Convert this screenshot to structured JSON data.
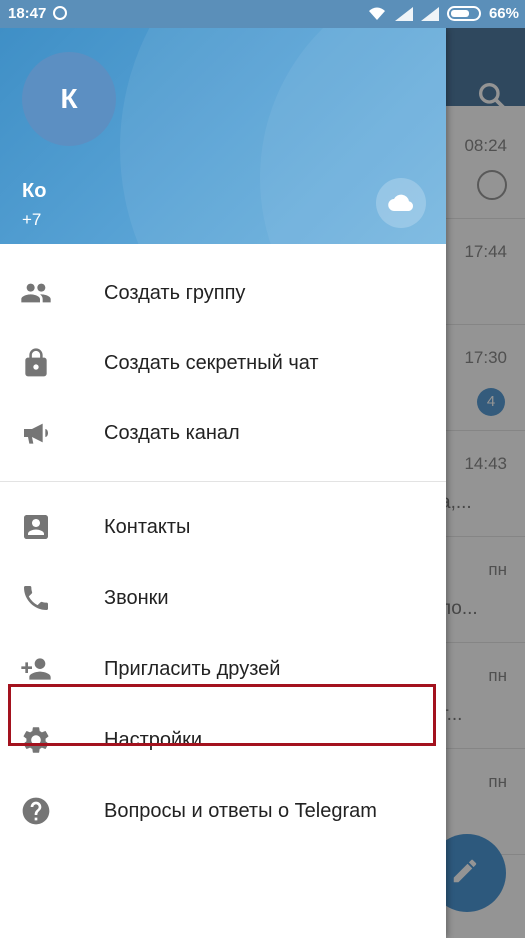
{
  "status_bar": {
    "time": "18:47",
    "battery": "66%"
  },
  "drawer": {
    "avatar_letter": "К",
    "user_name": "Ко",
    "user_phone": "+7",
    "menu_group_1": [
      {
        "label": "Создать группу",
        "icon": "group-icon"
      },
      {
        "label": "Создать секретный чат",
        "icon": "lock-icon"
      },
      {
        "label": "Создать канал",
        "icon": "megaphone-icon"
      }
    ],
    "menu_group_2": [
      {
        "label": "Контакты",
        "icon": "contact-card-icon"
      },
      {
        "label": "Звонки",
        "icon": "phone-icon"
      },
      {
        "label": "Пригласить друзей",
        "icon": "add-person-icon"
      },
      {
        "label": "Настройки",
        "icon": "gear-icon"
      },
      {
        "label": "Вопросы и ответы о Telegram",
        "icon": "help-icon"
      }
    ]
  },
  "background_chats": [
    {
      "time": "08:24",
      "snippet": ""
    },
    {
      "time": "17:44",
      "snippet": ""
    },
    {
      "time": "17:30",
      "snippet": "",
      "badge": "4"
    },
    {
      "time": "14:43",
      "snippet": "а,..."
    },
    {
      "time": "пн",
      "snippet": "ло..."
    },
    {
      "time": "пн",
      "snippet": "т..."
    },
    {
      "time": "пн",
      "snippet": ""
    }
  ],
  "colors": {
    "header_blue": "#527da3",
    "drawer_header": "#4e9bd0",
    "highlight_red": "#a3121e",
    "icon_gray": "#757575"
  }
}
